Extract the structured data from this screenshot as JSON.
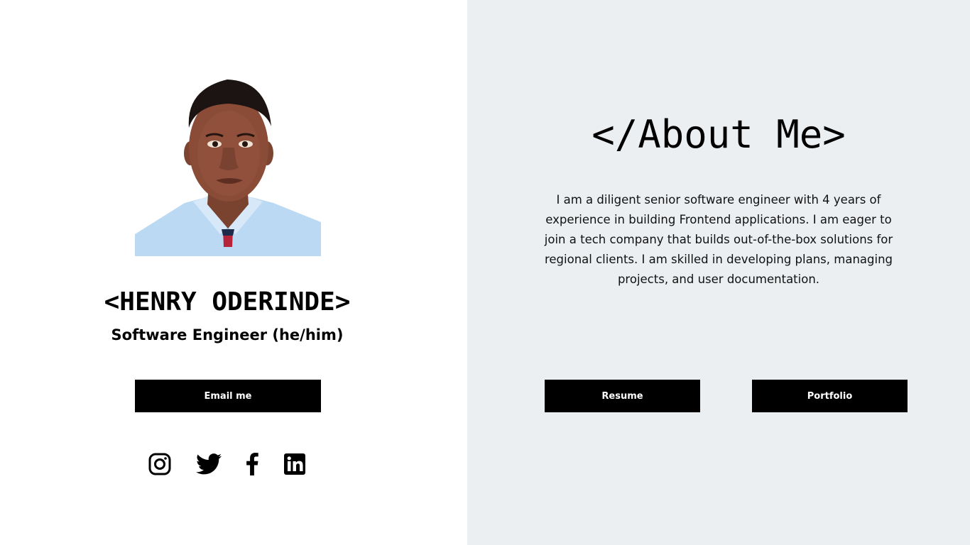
{
  "profile": {
    "name": "<HENRY ODERINDE>",
    "role": "Software Engineer (he/him)",
    "email_button": "Email me",
    "photo_icon": "profile-photo"
  },
  "socials": [
    {
      "icon": "instagram-icon"
    },
    {
      "icon": "twitter-icon"
    },
    {
      "icon": "facebook-icon"
    },
    {
      "icon": "linkedin-icon"
    }
  ],
  "about": {
    "title": "</About Me>",
    "text": "I am a diligent senior software engineer with 4 years of experience in building Frontend applications. I am eager to join a tech company that builds out-of-the-box solutions for regional clients. I am skilled in developing plans, managing projects, and user documentation.",
    "resume_button": "Resume",
    "portfolio_button": "Portfolio"
  },
  "colors": {
    "left_background": "#ffffff",
    "right_background": "#eceff2",
    "button_background": "#000000",
    "button_text": "#ffffff"
  }
}
